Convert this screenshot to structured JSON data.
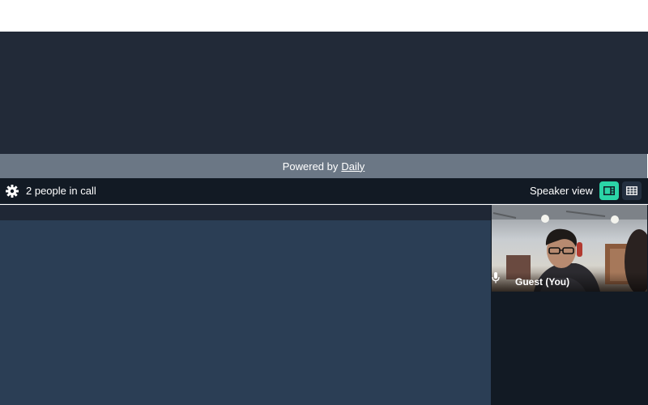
{
  "banner": {
    "prefix": "Powered by",
    "link_text": "Daily"
  },
  "toolbar": {
    "settings_icon": "gear-icon",
    "people_count_text": "2 people in call",
    "view_label": "Speaker view",
    "speaker_view_icon": "speaker-layout-icon",
    "grid_view_icon": "grid-layout-icon"
  },
  "participant": {
    "name": "Guest (You)",
    "mic_icon": "microphone-icon"
  },
  "colors": {
    "accent": "#2bd4a7",
    "toolbar_bg": "#121a24",
    "stage_bg": "#2b3e55",
    "banner_bg": "#6b7785"
  }
}
